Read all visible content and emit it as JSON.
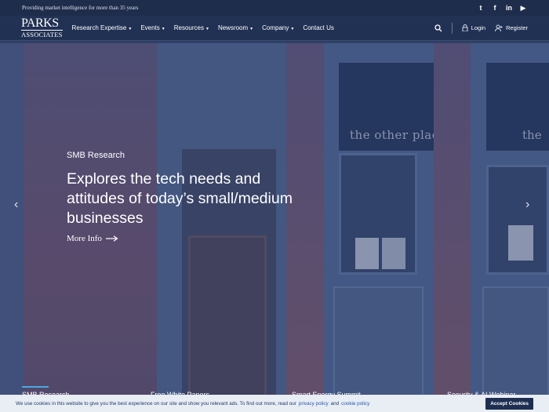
{
  "topbar": {
    "tagline": "Providing market intelligence for more than 35 years",
    "social": [
      {
        "icon": "twitter-icon",
        "glyph": "t"
      },
      {
        "icon": "facebook-icon",
        "glyph": "f"
      },
      {
        "icon": "linkedin-icon",
        "glyph": "in"
      },
      {
        "icon": "youtube-icon",
        "glyph": "▶"
      }
    ]
  },
  "logo": {
    "line1": "PARKS",
    "line2": "ASSOCIATES"
  },
  "nav": {
    "items": [
      {
        "label": "Research Expertise",
        "dropdown": true
      },
      {
        "label": "Events",
        "dropdown": true
      },
      {
        "label": "Resources",
        "dropdown": true
      },
      {
        "label": "Newsroom",
        "dropdown": true
      },
      {
        "label": "Company",
        "dropdown": true
      },
      {
        "label": "Contact Us",
        "dropdown": false
      }
    ],
    "login": "Login",
    "register": "Register"
  },
  "hero": {
    "sign_left": "the other place",
    "sign_right": "the",
    "eyebrow": "SMB Research",
    "headline": "Explores the tech needs and attitudes of today’s small/medium businesses",
    "cta": "More Info"
  },
  "slides": [
    {
      "label": "SMB Research",
      "active": true
    },
    {
      "label": "Free White Papers",
      "active": false
    },
    {
      "label": "Smart Energy Summit",
      "active": false
    },
    {
      "label": "Security & AI Webinar",
      "active": false
    }
  ],
  "cookie": {
    "text": "We use cookies in this website to give you the best experience on our site and show you relevant ads. To find out more, read our",
    "privacy": "privacy policy",
    "and": "and",
    "cookie_policy": "cookie policy",
    "accept": "Accept Cookies"
  },
  "colors": {
    "topbar": "#1f2d4c",
    "accent": "#4aa9e0",
    "accept_bg": "#1e2f52"
  }
}
